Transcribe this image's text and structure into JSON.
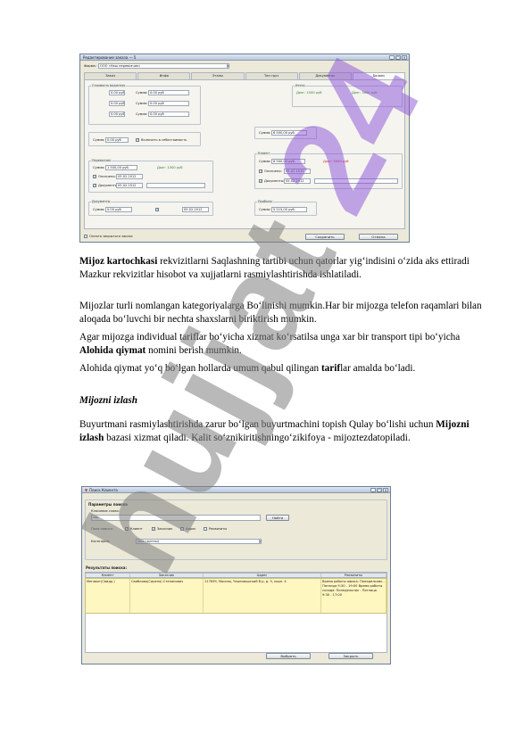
{
  "window1": {
    "title": "Редактирование заказа — 5",
    "firm_label": "Фирма:",
    "firm_value": "ООО «Наш перевозчик»",
    "tabs": [
      "Заказ",
      "Инфо",
      "Этапы",
      "Тип груз",
      "Документы",
      "Баланс"
    ],
    "active_tab": "Баланс",
    "bottom_checkbox": "Оплата закрытого заказа",
    "save_button": "Сохранить",
    "cancel_button": "Отмена",
    "group_costs": "Стоимость водителя",
    "group_client": "Клиент",
    "group_profit": "Прибыль",
    "group_carrier": "Перевозчик",
    "group_docs": "Документы",
    "group_balance": "Итого",
    "sum_label": "Сумма:",
    "paid_label": "Оплачено:",
    "docs_label": "Документы:",
    "sum_values": [
      "0.00 руб",
      "0.00 руб",
      "0.00 руб"
    ],
    "client_sum": "6 500,00 руб.",
    "carrier_sum": "1 500,00 руб.",
    "profit_sum": "5 515,00 руб.",
    "debt_text": "Долг: 5000 руб",
    "date_value": "05.02.2012",
    "nds_label": "Включить в себестоимость",
    "status_green_1": "Долг: 1500 руб",
    "status_green_2": "Долг: 5000 руб"
  },
  "paragraphs": {
    "p1_bold": "Mijoz kartochkasi",
    "p1_rest": "  rekvizitlarni Saqlashning  tartibi uchun qatorlar yig‘indisini o‘zida aks ettiradi Mazkur rekvizitlar hisobot va xujjatlarni rasmiylashtirishda ishlatiladi.",
    "p2": "Mijozlar turli nomlangan kategoriyalarga Bo‘linishi mumkin.Har bir mijozga telefon raqamlari bilan aloqada bo‘luvchi  bir nechta shaxslarni biriktirish mumkin.",
    "p3_a": "Agar mijozga individual  tariflar bo‘yicha xizmat ko‘rsatilsa unga  xar bir transport tipi bo‘yicha ",
    "p3_bold": "Alohida qiymat",
    "p3_b": " nomini berish mumkin.",
    "p4_a": "Alohida qiymat  yo‘q bo‘lgan hollarda umum qabul qilingan ",
    "p4_bold": "tarif",
    "p4_b": "lar amalda bo‘ladi.",
    "heading": "Mijozni izlash",
    "p5_a": "Buyurtmani rasmiylashtirishda zarur bo‘lgan buyurtmachini topish Qulay bo‘lishi uchun  ",
    "p5_bold": "Mijozni izlash",
    "p5_b": " bazasi  xizmat qiladi. Kalit so‘znikiritishningo‘zikifoya - mijoztezdatopiladi."
  },
  "window2": {
    "title": "Поиск Клиента",
    "group_params": "Параметры поиска",
    "keyword_label": "Ключевое слово:",
    "keyword_value": "сир",
    "find_button": "Найти",
    "search_by_label": "Поля поиска:",
    "search_by_options": [
      "Клиент",
      "Заказчик",
      "Адрес",
      "Реквизиты"
    ],
    "category_label": "Категория:",
    "category_value": "(все группы)",
    "results_title": "Результаты поиска:",
    "columns": [
      "Клиент",
      "Заказчик",
      "Адрес",
      "Реквизиты"
    ],
    "row": {
      "client": "Мегавит(Свидр.)",
      "customer": "Свиблово(Сиреня) Степанович",
      "address": "117639, Москва, Черноморский б-р, д. 5, корп. 4",
      "details": "Время работы офиса: Понедельник - Пятница 9:30 - 19:00  Время работы склада: Понедельник - Пятница 9:30 - 17:00"
    },
    "select_button": "Выбрать",
    "close_button": "Закрыть"
  },
  "watermark": "hujjat24",
  "colors": {
    "watermark_gray": "#7f7f7f",
    "watermark_purple": "#8a4fd8",
    "accent_blue": "#2f4f8f"
  }
}
